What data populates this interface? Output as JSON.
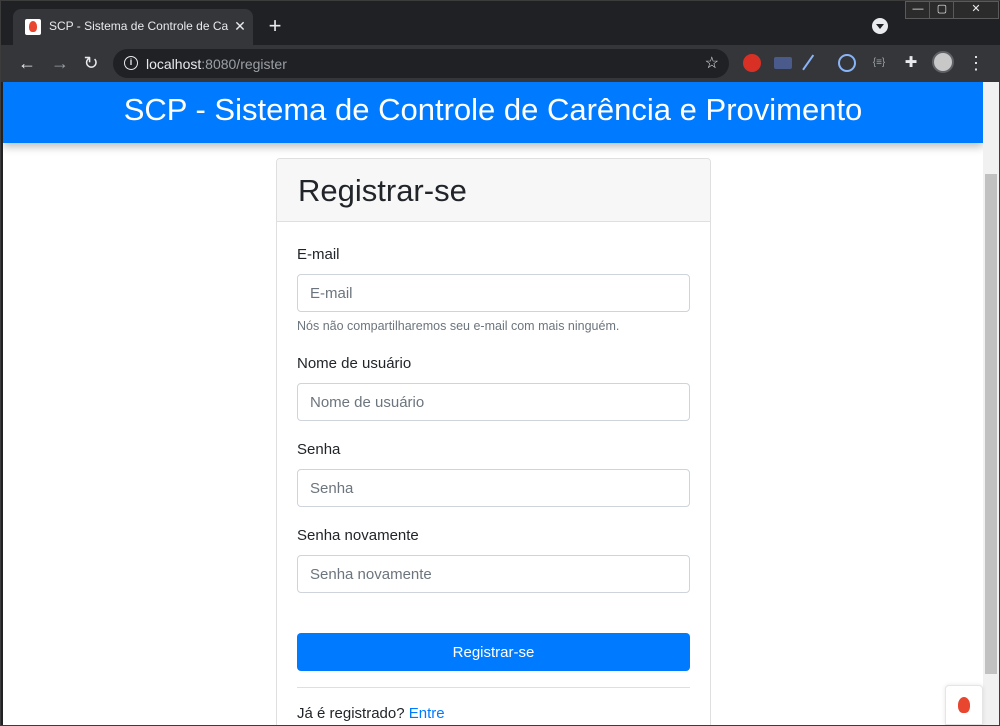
{
  "browser": {
    "tab_title": "SCP - Sistema de Controle de Carência e Provimento",
    "tab_close": "✕",
    "new_tab": "+",
    "url_host": "localhost",
    "url_path": ":8080/register",
    "window_controls": {
      "minimize": "—",
      "maximize": "▢",
      "close": "✕"
    },
    "nav": {
      "back": "←",
      "forward": "→",
      "reload": "↻"
    },
    "extensions": [
      "adblock-icon",
      "devtools-icon",
      "pen-icon",
      "react-icon",
      "json-icon",
      "puzzle-icon"
    ]
  },
  "header": {
    "title": "SCP - Sistema de Controle de Carência e Provimento"
  },
  "card": {
    "title": "Registrar-se",
    "fields": {
      "email": {
        "label": "E-mail",
        "placeholder": "E-mail",
        "help": "Nós não compartilharemos seu e-mail com mais ninguém."
      },
      "username": {
        "label": "Nome de usuário",
        "placeholder": "Nome de usuário"
      },
      "password": {
        "label": "Senha",
        "placeholder": "Senha"
      },
      "password_confirm": {
        "label": "Senha novamente",
        "placeholder": "Senha novamente"
      }
    },
    "submit_label": "Registrar-se",
    "login_prompt": "Já é registrado? ",
    "login_link": "Entre"
  },
  "colors": {
    "primary": "#007bff",
    "chrome_dark": "#202124",
    "chrome_toolbar": "#35363a"
  }
}
